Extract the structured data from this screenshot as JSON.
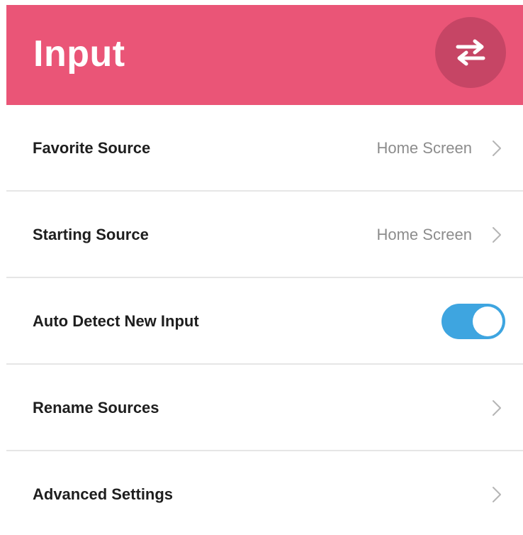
{
  "header": {
    "title": "Input",
    "swap_icon": "swap-arrows-icon",
    "background_color": "#ea5577",
    "button_color": "#c64565"
  },
  "settings": [
    {
      "label": "Favorite Source",
      "value": "Home Screen",
      "type": "link",
      "icon": "chevron-right-icon"
    },
    {
      "label": "Starting Source",
      "value": "Home Screen",
      "type": "link",
      "icon": "chevron-right-icon"
    },
    {
      "label": "Auto Detect New Input",
      "type": "toggle",
      "checked": true,
      "toggle_color": "#3ea5e0"
    },
    {
      "label": "Rename Sources",
      "type": "link",
      "icon": "chevron-right-icon"
    },
    {
      "label": "Advanced Settings",
      "type": "link",
      "icon": "chevron-right-icon"
    }
  ]
}
